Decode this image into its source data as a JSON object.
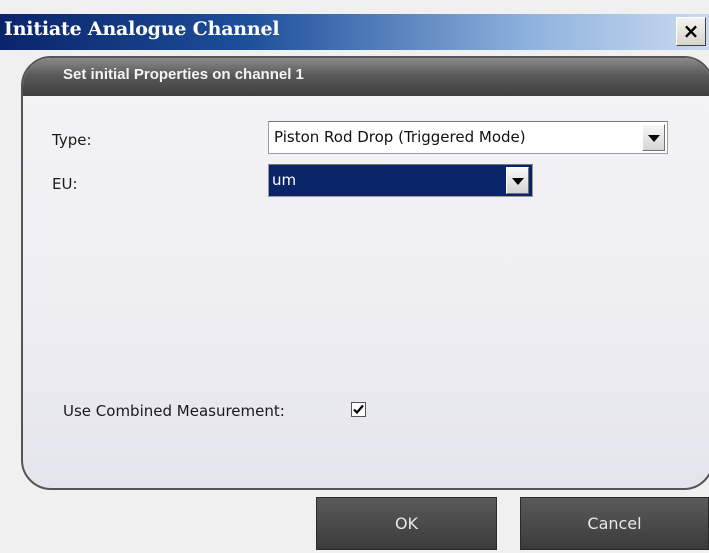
{
  "window": {
    "title": "Initiate Analogue Channel",
    "close_glyph": "×"
  },
  "panel": {
    "title": "Set initial Properties on channel 1"
  },
  "fields": {
    "type_label": "Type:",
    "type_value": "Piston Rod Drop (Triggered Mode)",
    "eu_label": "EU:",
    "eu_value": "um",
    "combined_label": "Use Combined Measurement:",
    "combined_checked": true
  },
  "buttons": {
    "ok": "OK",
    "cancel": "Cancel"
  },
  "colors": {
    "title_bar_start": "#0a246a",
    "panel_header": "#4a4a4a",
    "selection": "#0a2468",
    "button_bg": "#474747"
  },
  "icons": {
    "close": "close-icon",
    "dropdown": "chevron-down-icon",
    "check": "checkmark-icon"
  }
}
